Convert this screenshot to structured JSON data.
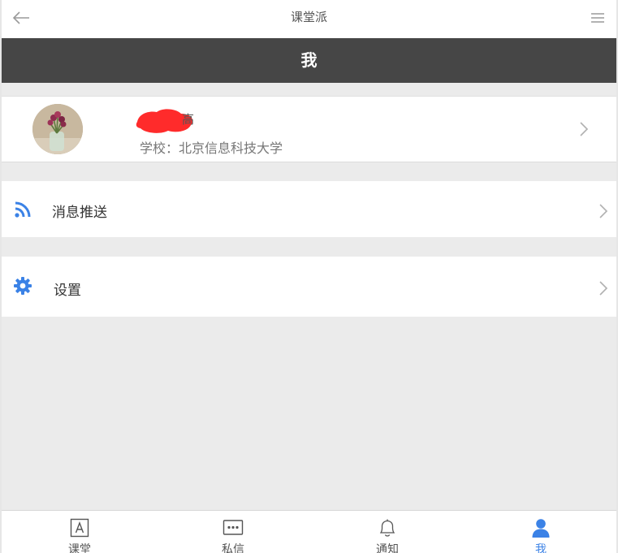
{
  "appbar": {
    "title": "课堂派",
    "back_icon": "arrow-left-icon",
    "menu_icon": "hamburger-menu-icon"
  },
  "header": {
    "title": "我"
  },
  "profile": {
    "name_visible_part": "高",
    "school": "学校：北京信息科技大学",
    "avatar": "flower-vase-photo"
  },
  "menu": [
    {
      "label": "消息推送",
      "icon": "rss-feed-icon"
    },
    {
      "label": "设置",
      "icon": "gear-icon"
    }
  ],
  "tabs": [
    {
      "label": "课堂",
      "icon": "class-icon"
    },
    {
      "label": "私信",
      "icon": "message-icon"
    },
    {
      "label": "通知",
      "icon": "bell-icon"
    },
    {
      "label": "我",
      "icon": "user-icon",
      "active": true
    }
  ],
  "colors": {
    "accent": "#3b82e6",
    "header_bg": "#464646",
    "page_bg": "#ebebeb",
    "redaction": "#ff2b2b"
  }
}
